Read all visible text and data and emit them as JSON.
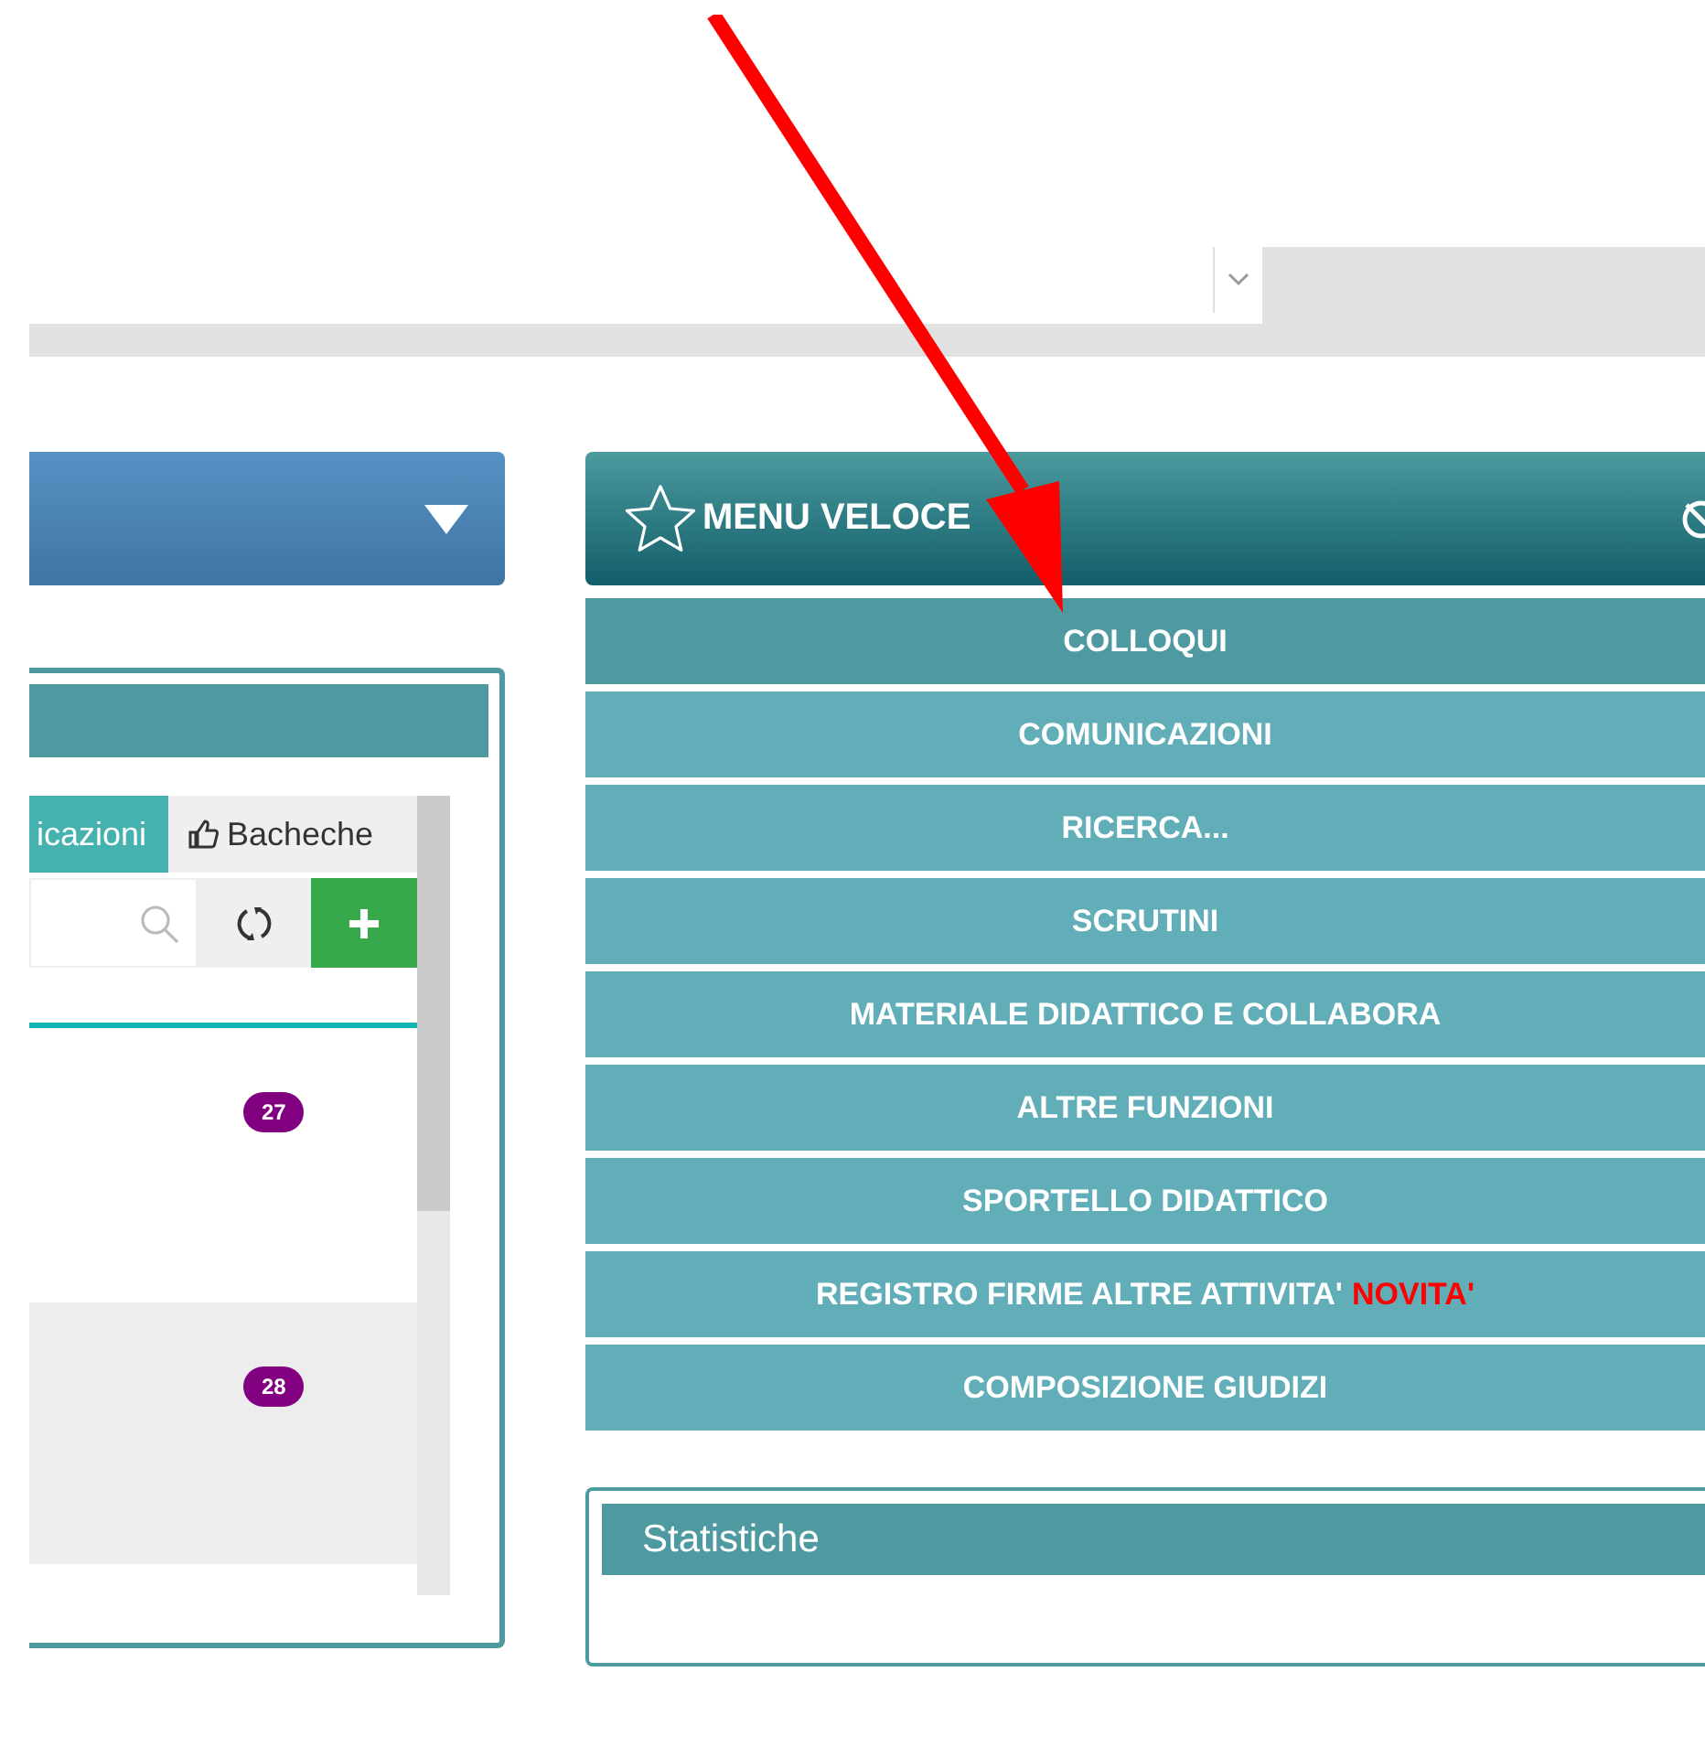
{
  "left_panel": {
    "tabs": [
      {
        "label": "icazioni",
        "selected": true,
        "kind": "text"
      },
      {
        "label": "Bacheche",
        "selected": false,
        "kind": "thumb"
      }
    ],
    "items": [
      {
        "badge": "27",
        "selected": false
      },
      {
        "badge": "28",
        "selected": true
      }
    ]
  },
  "quick_menu": {
    "title": "MENU VELOCE",
    "items": [
      {
        "label": "COLLOQUI",
        "selected": true
      },
      {
        "label": "COMUNICAZIONI",
        "selected": false
      },
      {
        "label": "RICERCA...",
        "selected": false
      },
      {
        "label": "SCRUTINI",
        "selected": false
      },
      {
        "label": "MATERIALE DIDATTICO E COLLABORA",
        "selected": false
      },
      {
        "label": "ALTRE FUNZIONI",
        "selected": false
      },
      {
        "label": "SPORTELLO DIDATTICO",
        "selected": false
      },
      {
        "label": "REGISTRO FIRME ALTRE ATTIVITA'",
        "tag": "NOVITA'",
        "selected": false
      },
      {
        "label": "COMPOSIZIONE GIUDIZI",
        "selected": false
      }
    ]
  },
  "stats_panel": {
    "title": "Statistiche"
  }
}
